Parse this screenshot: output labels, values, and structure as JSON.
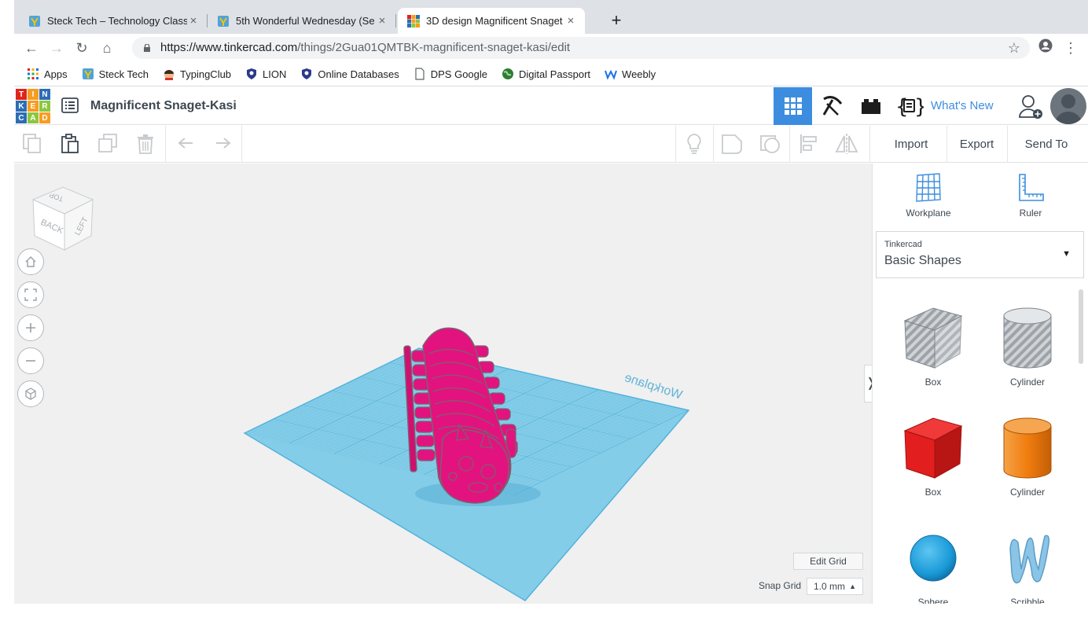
{
  "browser": {
    "tabs": [
      {
        "title": "Steck Tech – Technology Class",
        "active": false
      },
      {
        "title": "5th Wonderful Wednesday (Se",
        "active": false
      },
      {
        "title": "3D design Magnificent Snaget",
        "active": true
      }
    ],
    "url_host": "https://www.tinkercad.com",
    "url_path": "/things/2Gua01QMTBK-magnificent-snaget-kasi/edit",
    "bookmarks": [
      "Apps",
      "Steck Tech",
      "TypingClub",
      "LION",
      "Online Databases",
      "DPS Google",
      "Digital Passport",
      "Weebly"
    ]
  },
  "header": {
    "logo_letters": [
      "T",
      "I",
      "N",
      "K",
      "E",
      "R",
      "C",
      "A",
      "D"
    ],
    "logo_colors": [
      "#e2231a",
      "#f79c21",
      "#2c6db5",
      "#2c6db5",
      "#f79c21",
      "#8dc63f",
      "#2c6db5",
      "#8dc63f",
      "#f79c21"
    ],
    "design_title": "Magnificent Snaget-Kasi",
    "whats_new": "What's New",
    "accent": "#3c8de0"
  },
  "edit_bar": {
    "import": "Import",
    "export": "Export",
    "send_to": "Send To"
  },
  "workspace": {
    "viewcube": {
      "top": "TOP",
      "back": "BACK",
      "left": "LEFT"
    },
    "workplane_watermark": "Workplane",
    "edit_grid": "Edit Grid",
    "snap_grid_label": "Snap Grid",
    "snap_grid_value": "1.0 mm",
    "plane_color": "#84cde8",
    "model_color": "#e2137f"
  },
  "panel": {
    "workplane": "Workplane",
    "ruler": "Ruler",
    "library_small": "Tinkercad",
    "library_name": "Basic Shapes",
    "shapes": [
      {
        "label": "Box",
        "style": "hole"
      },
      {
        "label": "Cylinder",
        "style": "hole"
      },
      {
        "label": "Box",
        "color": "#e31e1e"
      },
      {
        "label": "Cylinder",
        "color": "#f07d0f"
      },
      {
        "label": "Sphere",
        "color": "#1b9ad8"
      },
      {
        "label": "Scribble",
        "color": "#8ac4e6"
      }
    ]
  }
}
